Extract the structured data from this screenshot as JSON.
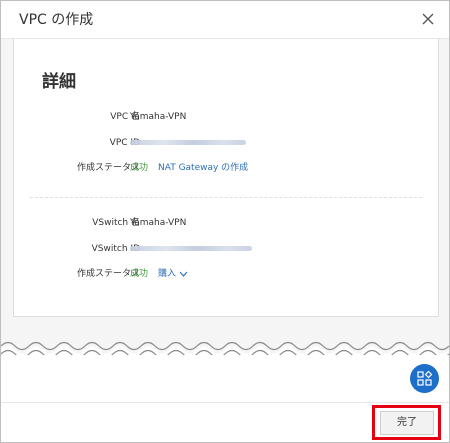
{
  "dialog": {
    "title": "VPC の作成",
    "close_icon": "close-icon"
  },
  "detail": {
    "section_title": "詳細",
    "vpc": {
      "name_label": "VPC 名",
      "name_value": "Yamaha-VPN",
      "id_label": "VPC ID",
      "id_value_redacted": true,
      "status_label": "作成ステータス",
      "status_value": "成功",
      "status_link": "NAT Gateway の作成"
    },
    "vswitch": {
      "name_label": "VSwitch 名",
      "name_value": "Yamaha-VPN",
      "id_label": "VSwitch ID",
      "id_value_redacted": true,
      "status_label": "作成ステータス",
      "status_value": "成功",
      "status_link": "購入",
      "status_link_icon": "chevron-down-icon"
    }
  },
  "floating_button_icon": "grid-shapes-icon",
  "footer": {
    "finish_label": "完了"
  },
  "colors": {
    "success": "#3e9a38",
    "link": "#2d6fb4",
    "fab": "#1e6fc9",
    "highlight": "#e60012"
  }
}
